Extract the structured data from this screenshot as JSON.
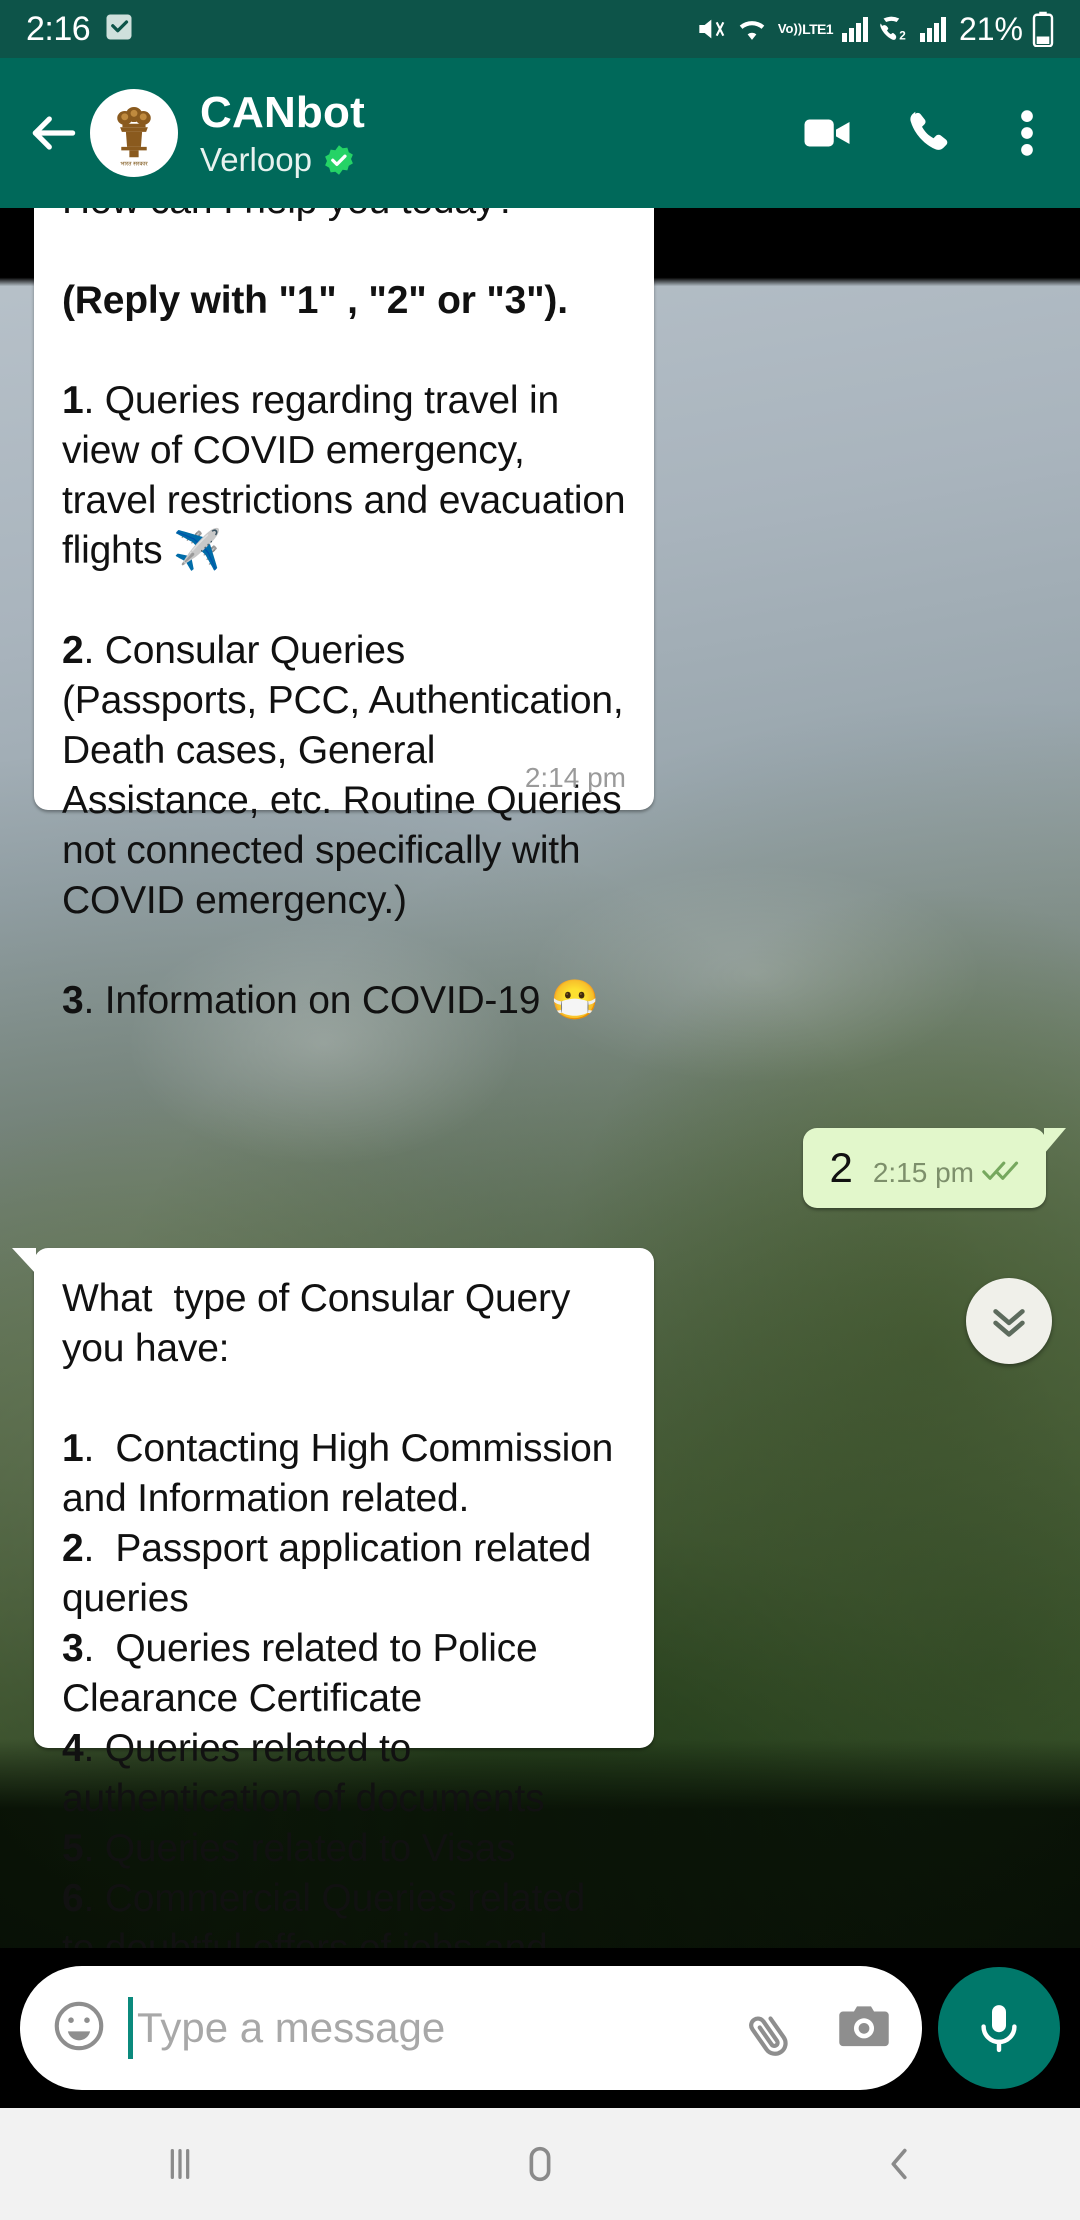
{
  "status_bar": {
    "time": "2:16",
    "battery_percent": "21%",
    "network_label": "VoLTE",
    "network_line1": "Vo))",
    "network_line2": "LTE1",
    "sim2_label": "2",
    "icons": [
      "notification-check-icon",
      "mute-icon",
      "wifi-icon",
      "volte-icon",
      "signal-icon",
      "call-sim2-icon",
      "signal-2-icon",
      "battery-icon"
    ],
    "colors": {
      "background": "#0d5449",
      "foreground": "#ffffff"
    }
  },
  "app_bar": {
    "title": "CANbot",
    "subtitle": "Verloop",
    "verified": true,
    "back_label": "back-arrow",
    "actions": [
      "video-call",
      "voice-call",
      "overflow-menu"
    ],
    "colors": {
      "background": "#00695a",
      "title": "#ffffff"
    }
  },
  "conversation": {
    "messages": [
      {
        "direction": "incoming",
        "time": "2:14 pm",
        "lines": [
          {
            "text": "How can I help you today?",
            "bold": false
          },
          {
            "text": "",
            "bold": false
          },
          {
            "text": "(Reply with \"1\" , \"2\" or \"3\").",
            "bold": true
          },
          {
            "text": "",
            "bold": false
          },
          {
            "prefix": "1",
            "text": ". Queries regarding travel in view of COVID emergency, travel restrictions and evacuation flights ✈️",
            "bold": false
          },
          {
            "text": "",
            "bold": false
          },
          {
            "prefix": "2",
            "text": ". Consular Queries\n(Passports, PCC, Authentication, Death cases, General Assistance, etc. Routine Queries not connected specifically with COVID emergency.)",
            "bold": false
          },
          {
            "text": "",
            "bold": false
          },
          {
            "prefix": "3",
            "text": ". Information on COVID-19 😷",
            "bold": false
          }
        ]
      },
      {
        "direction": "outgoing",
        "body": "2",
        "time": "2:15 pm",
        "status": "read",
        "status_icon": "double-check-icon"
      },
      {
        "direction": "incoming",
        "time": "",
        "lines": [
          {
            "text": "What  type of Consular Query you have:",
            "bold": false
          },
          {
            "text": "",
            "bold": false
          },
          {
            "prefix": "1",
            "text": ".  Contacting High Commission and Information related.",
            "bold": false
          },
          {
            "prefix": "2",
            "text": ".  Passport application related queries",
            "bold": false
          },
          {
            "prefix": "3",
            "text": ".  Queries related to Police Clearance Certificate",
            "bold": false
          },
          {
            "prefix": "4",
            "text": ". Queries related to authentication of documents",
            "bold": false
          },
          {
            "prefix": "5",
            "text": ". Queries related to Visas",
            "bold": false
          },
          {
            "prefix": "6",
            "text": ". Commercial Queries related to doubtful offers of jobs and businesses",
            "bold": false
          }
        ]
      }
    ],
    "scroll_down_button": "scroll-to-bottom"
  },
  "composer": {
    "placeholder": "Type a message",
    "value": "",
    "emoji_icon": "emoji-icon",
    "attach_icon": "paperclip-icon",
    "camera_icon": "camera-icon",
    "mic_icon": "microphone-icon",
    "mic_color": "#00786a"
  },
  "nav_bar": {
    "recents": "recents-button",
    "home": "home-button",
    "back": "back-button"
  }
}
